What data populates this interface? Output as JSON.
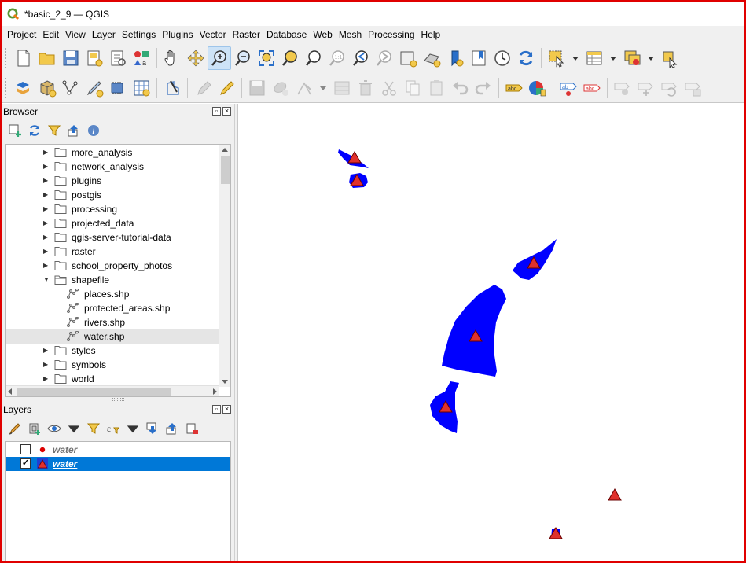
{
  "window": {
    "title": "*basic_2_9 — QGIS",
    "app_icon": "qgis-logo-icon"
  },
  "menubar": {
    "items": [
      "Project",
      "Edit",
      "View",
      "Layer",
      "Settings",
      "Plugins",
      "Vector",
      "Raster",
      "Database",
      "Web",
      "Mesh",
      "Processing",
      "Help"
    ]
  },
  "toolbar_main": {
    "icons": [
      "new-project-icon",
      "open-project-icon",
      "save-project-icon",
      "new-print-layout-icon",
      "layout-manager-icon",
      "style-manager-icon",
      "pan-icon",
      "pan-to-selection-icon",
      "zoom-in-icon",
      "zoom-out-icon",
      "zoom-full-icon",
      "zoom-to-selection-icon",
      "zoom-to-layer-icon",
      "zoom-native-icon",
      "zoom-last-icon",
      "zoom-next-icon",
      "new-map-view-icon",
      "new-3d-map-view-icon",
      "new-bookmark-icon",
      "show-bookmarks-icon",
      "temporal-controller-icon",
      "refresh-icon",
      "select-features-icon",
      "open-attribute-table-icon",
      "deselect-all-icon",
      "identify-features-icon"
    ],
    "active": "zoom-in-icon"
  },
  "toolbar_edit": {
    "icons": [
      "data-source-manager-icon",
      "new-geopackage-layer-icon",
      "new-vector-layer-icon",
      "new-shapefile-layer-icon",
      "new-temporary-layer-icon",
      "new-virtual-layer-icon",
      "digitize-icon",
      "current-edits-icon",
      "toggle-editing-icon",
      "save-edits-icon",
      "add-feature-icon",
      "vertex-tool-icon",
      "modify-attributes-icon",
      "delete-selected-icon",
      "cut-features-icon",
      "copy-features-icon",
      "paste-features-icon",
      "undo-icon",
      "redo-icon",
      "label-toolbar-icon",
      "diagram-options-icon",
      "highlight-pinned-labels-icon",
      "pin-labels-icon",
      "show-hide-labels-icon",
      "move-label-icon",
      "rotate-label-icon",
      "change-label-icon"
    ]
  },
  "browser": {
    "title": "Browser",
    "tool_icons": [
      "add-selected-layers-icon",
      "refresh-icon",
      "filter-browser-icon",
      "collapse-all-icon",
      "enable-properties-icon"
    ],
    "items": [
      {
        "label": "more_analysis",
        "type": "folder",
        "expanded": false,
        "indent": 0
      },
      {
        "label": "network_analysis",
        "type": "folder",
        "expanded": false,
        "indent": 0
      },
      {
        "label": "plugins",
        "type": "folder",
        "expanded": false,
        "indent": 0
      },
      {
        "label": "postgis",
        "type": "folder",
        "expanded": false,
        "indent": 0
      },
      {
        "label": "processing",
        "type": "folder",
        "expanded": false,
        "indent": 0
      },
      {
        "label": "projected_data",
        "type": "folder",
        "expanded": false,
        "indent": 0
      },
      {
        "label": "qgis-server-tutorial-data",
        "type": "folder",
        "expanded": false,
        "indent": 0
      },
      {
        "label": "raster",
        "type": "folder",
        "expanded": false,
        "indent": 0
      },
      {
        "label": "school_property_photos",
        "type": "folder",
        "expanded": false,
        "indent": 0
      },
      {
        "label": "shapefile",
        "type": "folder-open",
        "expanded": true,
        "indent": 0
      },
      {
        "label": "places.shp",
        "type": "shapefile",
        "indent": 1
      },
      {
        "label": "protected_areas.shp",
        "type": "shapefile",
        "indent": 1
      },
      {
        "label": "rivers.shp",
        "type": "shapefile",
        "indent": 1
      },
      {
        "label": "water.shp",
        "type": "shapefile",
        "indent": 1,
        "selected": true
      },
      {
        "label": "styles",
        "type": "folder",
        "expanded": false,
        "indent": 0
      },
      {
        "label": "symbols",
        "type": "folder",
        "expanded": false,
        "indent": 0
      },
      {
        "label": "world",
        "type": "folder",
        "expanded": false,
        "indent": 0
      }
    ]
  },
  "layers": {
    "title": "Layers",
    "tool_icons": [
      "open-layer-styling-icon",
      "add-group-icon",
      "manage-map-themes-icon",
      "filter-legend-icon",
      "filter-by-expression-icon",
      "expand-all-icon",
      "collapse-all-icon",
      "remove-layer-icon"
    ],
    "items": [
      {
        "label": "water",
        "checked": false,
        "symbol": "red-dot-icon",
        "selected": false
      },
      {
        "label": "water",
        "checked": true,
        "symbol": "red-triangle-icon",
        "selected": true
      }
    ]
  },
  "map": {
    "polygon_color": "#0000ff",
    "marker_fill": "#e0312c",
    "marker_stroke": "#6a0000"
  },
  "colors": {
    "accent_frame": "#e00000",
    "selection": "#0078d7"
  }
}
